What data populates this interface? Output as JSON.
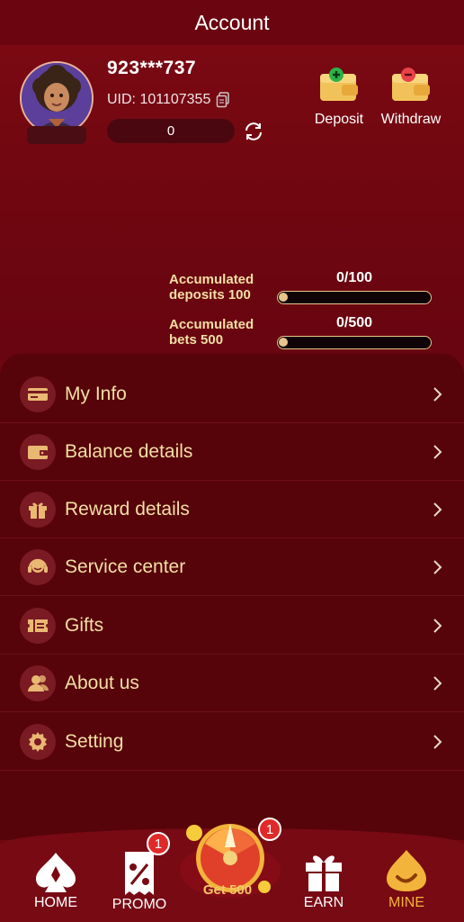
{
  "header": {
    "title": "Account"
  },
  "profile": {
    "username": "923***737",
    "uid_text": "UID: 101107355",
    "balance": "0"
  },
  "actions": {
    "deposit_label": "Deposit",
    "withdraw_label": "Withdraw"
  },
  "progress": [
    {
      "label": "Accumulated deposits 100",
      "value_text": "0/100",
      "current": 0,
      "target": 100
    },
    {
      "label": "Accumulated bets 500",
      "value_text": "0/500",
      "current": 0,
      "target": 500
    }
  ],
  "menu": {
    "items": [
      {
        "label": "My Info",
        "icon": "card-icon"
      },
      {
        "label": "Balance details",
        "icon": "wallet-icon"
      },
      {
        "label": "Reward details",
        "icon": "gift-icon"
      },
      {
        "label": "Service center",
        "icon": "headset-icon"
      },
      {
        "label": "Gifts",
        "icon": "ticket-icon"
      },
      {
        "label": "About us",
        "icon": "users-icon"
      },
      {
        "label": "Setting",
        "icon": "gear-icon"
      }
    ]
  },
  "nav": {
    "home_label": "HOME",
    "promo_label": "PROMO",
    "promo_badge": "1",
    "spin_label": "Get 500",
    "spin_badge": "1",
    "earn_label": "EARN",
    "mine_label": "MINE"
  },
  "colors": {
    "background": "#6e0610",
    "menu_text": "#f4dfa5",
    "accent_gold": "#f2b43a",
    "badge_red": "#e02a2a"
  }
}
